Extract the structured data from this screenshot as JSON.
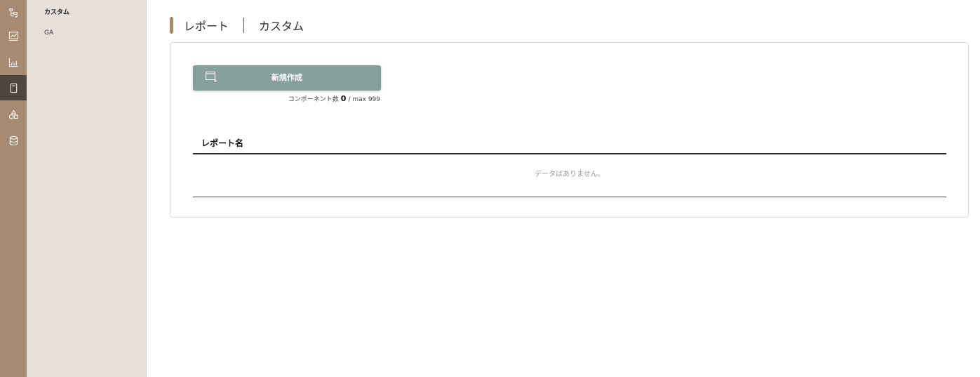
{
  "rail": {
    "items": [
      {
        "icon": "sitemap-check-icon",
        "active": false
      },
      {
        "icon": "line-chart-icon",
        "active": false
      },
      {
        "icon": "bar-chart-icon",
        "active": false
      },
      {
        "icon": "document-icon",
        "active": true
      },
      {
        "icon": "shapes-icon",
        "active": false
      },
      {
        "icon": "database-icon",
        "active": false
      }
    ]
  },
  "subnav": {
    "title": "カスタム",
    "items": [
      "GA"
    ]
  },
  "header": {
    "crumb1": "レポート",
    "crumb2": "カスタム"
  },
  "toolbar": {
    "new_label": "新規作成"
  },
  "count": {
    "label": "コンポーネント数",
    "value": "0",
    "max_text": "/ max 999"
  },
  "table": {
    "column": "レポート名",
    "empty_text": "データはありません。"
  },
  "colors": {
    "rail": "#a78a72",
    "rail_active": "#4f463d",
    "subnav": "#e6e0d8",
    "button": "#86a19c"
  }
}
